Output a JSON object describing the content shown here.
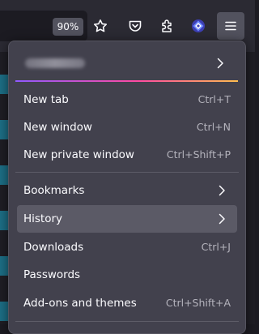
{
  "toolbar": {
    "zoom_level": "90%",
    "icons": [
      "star-icon",
      "pocket-icon",
      "extensions-icon",
      "extension-app-icon",
      "hamburger-menu-icon"
    ]
  },
  "menu": {
    "account_icon": "chevron-right-icon",
    "section1": [
      {
        "label": "New tab",
        "shortcut": "Ctrl+T"
      },
      {
        "label": "New window",
        "shortcut": "Ctrl+N"
      },
      {
        "label": "New private window",
        "shortcut": "Ctrl+Shift+P"
      }
    ],
    "section2": [
      {
        "label": "Bookmarks"
      },
      {
        "label": "History"
      },
      {
        "label": "Downloads",
        "shortcut": "Ctrl+J"
      },
      {
        "label": "Passwords"
      },
      {
        "label": "Add-ons and themes",
        "shortcut": "Ctrl+Shift+A"
      }
    ]
  },
  "colors": {
    "panel": "#42414d",
    "toolbar": "#2b2a33",
    "hover": "#5b5a66",
    "accent_gradient": [
      "#9059ff",
      "#ff4aa2",
      "#ffbd4f"
    ]
  }
}
